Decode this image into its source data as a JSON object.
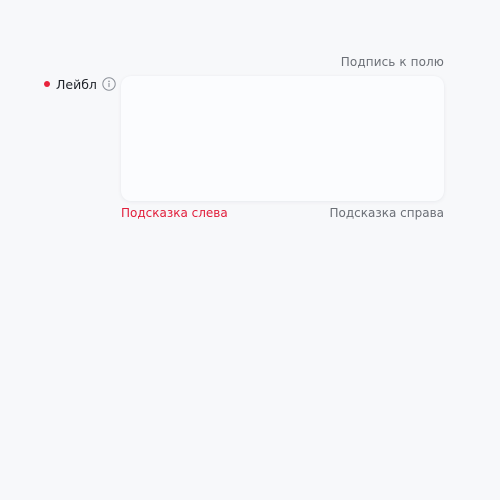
{
  "field": {
    "caption": "Подпись к полю",
    "label": "Лейбл",
    "required": true,
    "info_icon": "info-circle-icon",
    "value": "",
    "hint_left": "Подсказка слева",
    "hint_right": "Подсказка справа"
  },
  "colors": {
    "background": "#f7f8fa",
    "required_dot": "#e8243c",
    "error_hint": "#e11d3a",
    "secondary_text": "#6b6f76",
    "field_background": "#fbfcfe"
  }
}
